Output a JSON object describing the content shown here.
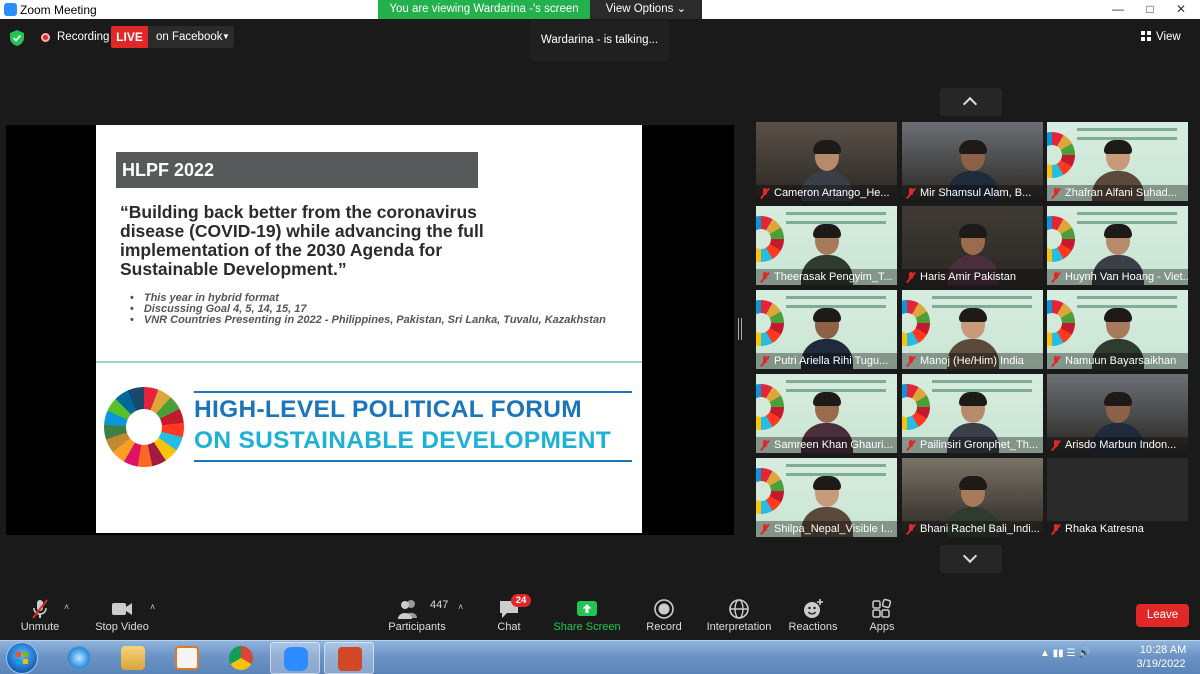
{
  "window": {
    "title": "Zoom Meeting",
    "minimize": "—",
    "maximize": "□",
    "close": "✕"
  },
  "top_banner": {
    "viewing_text": "You are viewing Wardarina -'s screen",
    "view_options": "View Options ⌄"
  },
  "meeting_bar": {
    "recording_label": "Recording",
    "live_label": "LIVE",
    "stream_label": "on Facebook",
    "talking_text": "Wardarina - is talking...",
    "view_label": "View"
  },
  "slide": {
    "header": "HLPF 2022",
    "quote_lines": [
      "“Building back better from the coronavirus",
      "disease (COVID-19) while advancing the full",
      "implementation of the 2030 Agenda for",
      "Sustainable Development.”"
    ],
    "bullets": [
      "This year in hybrid format",
      "Discussing Goal 4, 5, 14, 15, 17",
      "VNR Countries Presenting in 2022 - Philippines, Pakistan, Sri Lanka, Tuvalu, Kazakhstan"
    ],
    "forum_line1": "HIGH-LEVEL POLITICAL FORUM",
    "forum_line2": "ON SUSTAINABLE DEVELOPMENT"
  },
  "gallery": {
    "participants": [
      {
        "name": "Cameron Artango_He...",
        "bg": "room"
      },
      {
        "name": "Mir Shamsul Alam, B...",
        "bg": "room"
      },
      {
        "name": "Zhafran Alfani Suhad...",
        "bg": "banner"
      },
      {
        "name": "Theerasak Pengyim_T...",
        "bg": "banner"
      },
      {
        "name": "Haris Amir Pakistan",
        "bg": "room"
      },
      {
        "name": "Huynh Van Hoang - Viet...",
        "bg": "banner"
      },
      {
        "name": "Putri Ariella Rihi Tugu...",
        "bg": "banner"
      },
      {
        "name": "Manoj (He/Him) India",
        "bg": "banner"
      },
      {
        "name": "Namuun Bayarsaikhan",
        "bg": "banner"
      },
      {
        "name": "Samreen Khan Ghauri...",
        "bg": "banner"
      },
      {
        "name": "Pailinsiri Gronphet_Th...",
        "bg": "banner"
      },
      {
        "name": "Arisdo Marbun Indon...",
        "bg": "room"
      },
      {
        "name": "Shilpa_Nepal_Visible I...",
        "bg": "banner"
      },
      {
        "name": "Bhani Rachel Bali_Indi...",
        "bg": "room"
      },
      {
        "name": "Rhaka Katresna",
        "bg": "none"
      }
    ]
  },
  "toolbar": {
    "unmute": "Unmute",
    "stop_video": "Stop Video",
    "participants": "Participants",
    "participants_count": "447",
    "chat": "Chat",
    "chat_badge": "24",
    "share_screen": "Share Screen",
    "record": "Record",
    "interpretation": "Interpretation",
    "reactions": "Reactions",
    "apps": "Apps",
    "leave": "Leave",
    "caret": "˄"
  },
  "taskbar": {
    "time": "10:28 AM",
    "date": "3/19/2022"
  },
  "colors": {
    "live_red": "#e02828",
    "share_green": "#22b14c",
    "zoom_blue": "#2d8cff",
    "hlpf_blue": "#1b75bb",
    "hlpf_cyan": "#1db1d6"
  }
}
